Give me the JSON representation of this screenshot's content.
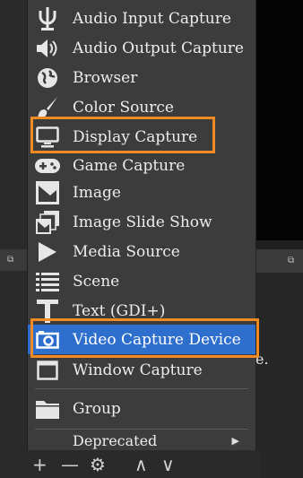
{
  "menu": {
    "items": [
      {
        "label": "Audio Input Capture",
        "icon": "microphone-icon"
      },
      {
        "label": "Audio Output Capture",
        "icon": "speaker-icon"
      },
      {
        "label": "Browser",
        "icon": "globe-icon"
      },
      {
        "label": "Color Source",
        "icon": "paintbrush-icon"
      },
      {
        "label": "Display Capture",
        "icon": "monitor-icon"
      },
      {
        "label": "Game Capture",
        "icon": "gamepad-icon"
      },
      {
        "label": "Image",
        "icon": "image-icon"
      },
      {
        "label": "Image Slide Show",
        "icon": "slideshow-icon"
      },
      {
        "label": "Media Source",
        "icon": "play-icon"
      },
      {
        "label": "Scene",
        "icon": "list-icon"
      },
      {
        "label": "Text (GDI+)",
        "icon": "text-icon"
      },
      {
        "label": "Video Capture Device",
        "icon": "camera-icon"
      },
      {
        "label": "Window Capture",
        "icon": "window-icon"
      },
      {
        "label": "Group",
        "icon": "folder-icon"
      },
      {
        "label": "Deprecated",
        "icon": "chevron-right-icon"
      }
    ],
    "selected": "Video Capture Device"
  },
  "background": {
    "partial_text": "e.",
    "toolbar": {
      "add": "+",
      "remove": "—",
      "settings": "⚙",
      "up": "∧",
      "down": "∨"
    }
  },
  "colors": {
    "menu_bg": "#3c3c3c",
    "highlight": "#2e6fce",
    "callout": "#f08a24"
  }
}
